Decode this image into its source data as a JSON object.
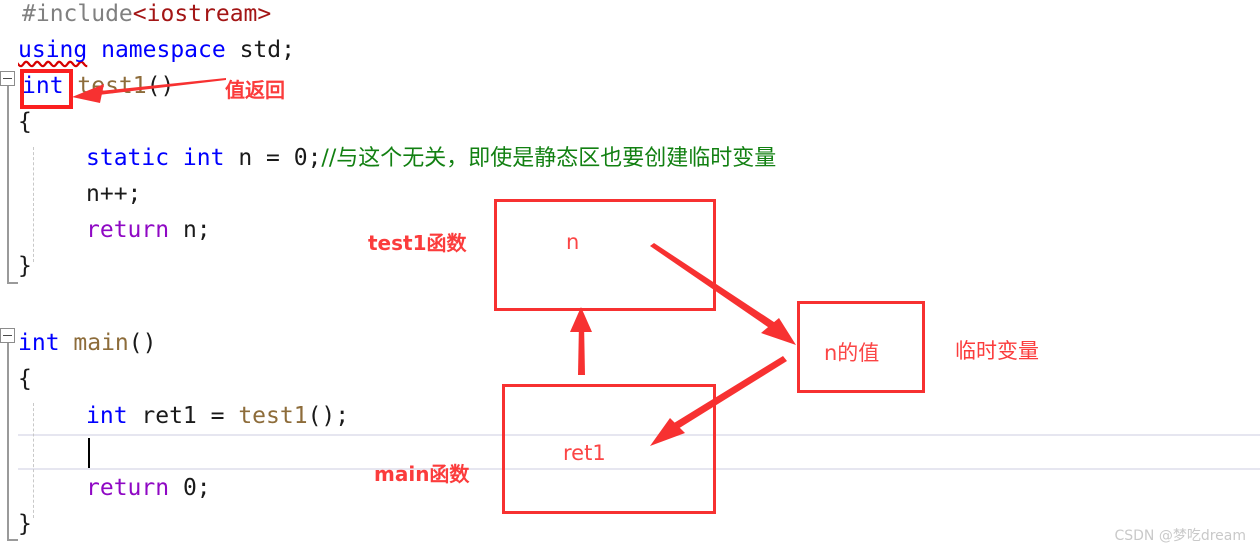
{
  "editor": {
    "language": "cpp",
    "background": "#ffffff",
    "current_line_highlight": "#e6e6f0",
    "lines": [
      {
        "indent": 0,
        "text": "#include<iostream>"
      },
      {
        "indent": 0,
        "text": "using namespace std;"
      },
      {
        "indent": 0,
        "text": "int test1()"
      },
      {
        "indent": 0,
        "text": "{"
      },
      {
        "indent": 1,
        "text": "static int n = 0;//与这个无关，即使是静态区也要创建临时变量"
      },
      {
        "indent": 1,
        "text": "n++;"
      },
      {
        "indent": 1,
        "text": "return n;"
      },
      {
        "indent": 0,
        "text": "}"
      },
      {
        "indent": 0,
        "text": ""
      },
      {
        "indent": 0,
        "text": "int main()"
      },
      {
        "indent": 0,
        "text": "{"
      },
      {
        "indent": 1,
        "text": "int ret1 = test1();"
      },
      {
        "indent": 1,
        "text": ""
      },
      {
        "indent": 1,
        "text": "return 0;"
      },
      {
        "indent": 0,
        "text": "}"
      }
    ],
    "tokens": {
      "include_directive": "#include",
      "include_header": "<iostream>",
      "using_kw": "using",
      "namespace_kw": " namespace",
      "std_name": " std;",
      "int_kw": "int",
      "test1_name": " test1",
      "parens": "()",
      "open_brace": "{",
      "close_brace": "}",
      "static_int_kw": "static int",
      "n_assign": " n = 0;",
      "comment_static": "//与这个无关，即使是静态区也要创建临时变量",
      "n_increment": "n++;",
      "return_kw": "return",
      "return_n": " n;",
      "return_zero": " 0;",
      "main_name": " main",
      "int_ret1": "int",
      "ret1_assign": " ret1 = ",
      "test1_call": "test1",
      "call_end": ";"
    }
  },
  "annotations": {
    "accent_color": "#fb3c3c",
    "box_border_color": "#f73131",
    "keyword_box_color": "#fb1f1f",
    "value_return_label": "值返回",
    "test1_func_label": "test1函数",
    "main_func_label": "main函数",
    "temp_var_label": "临时变量",
    "boxes": [
      {
        "id": "n-box",
        "label": "n"
      },
      {
        "id": "nvalue-box",
        "label": "n的值"
      },
      {
        "id": "ret1-box",
        "label": "ret1"
      }
    ]
  },
  "watermark": {
    "text": "CSDN @梦吃dream"
  }
}
